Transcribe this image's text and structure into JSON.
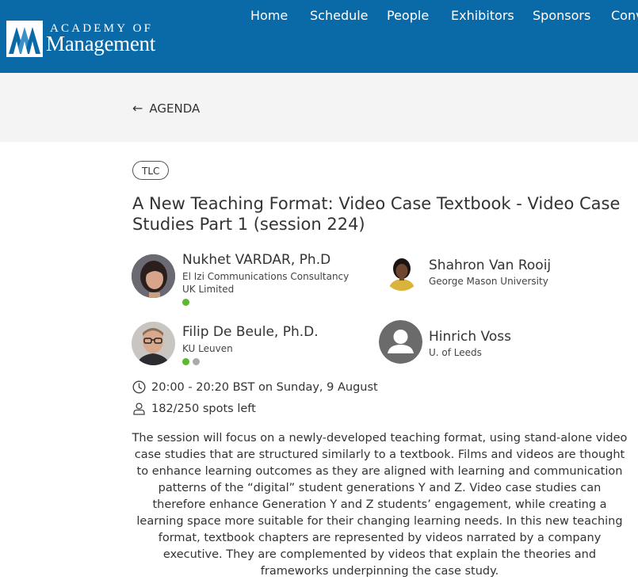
{
  "header": {
    "logo_top": "ACADEMY OF",
    "logo_bottom": "Management",
    "nav": [
      "Home",
      "Schedule",
      "People",
      "Exhibitors",
      "Sponsors",
      "Conv"
    ]
  },
  "back": {
    "label": "AGENDA",
    "icon": "arrow-left-icon"
  },
  "session": {
    "tag": "TLC",
    "title": "A New Teaching Format: Video Case Textbook - Video Case Studies Part 1 (session 224)",
    "time": "20:00 - 20:20 BST on Sunday, 9 August",
    "spots": "182/250 spots left",
    "description": "The session will focus on a newly-developed teaching format, using stand-alone video case studies that are structured similarly to a textbook. Films and videos are thought to enhance learning outcomes as they are aligned with learning and communication patterns of the “digital” student generations Y and Z. Video case studies can therefore enhance Generation Y and Z students’ engagement, while creating a learning space more suitable for their changing learning needs. In this new teaching format, textbook chapters are represented by videos narrated by a company executive. They are complemented by videos that explain the theories and frameworks underpinning the case study."
  },
  "speakers": [
    {
      "name": "Nukhet VARDAR, Ph.D",
      "affiliation": "El Izi Communications Consultancy UK Limited"
    },
    {
      "name": "Shahron Van Rooij",
      "affiliation": "George Mason University"
    },
    {
      "name": "Filip De Beule, Ph.D.",
      "affiliation": "KU Leuven"
    },
    {
      "name": "Hinrich Voss",
      "affiliation": "U. of Leeds"
    }
  ],
  "colors": {
    "header_bg": "#0a6aa8",
    "backbar_bg": "#f4f4f4",
    "status_green": "#5cb82e",
    "status_gray": "#aaaaaa"
  }
}
